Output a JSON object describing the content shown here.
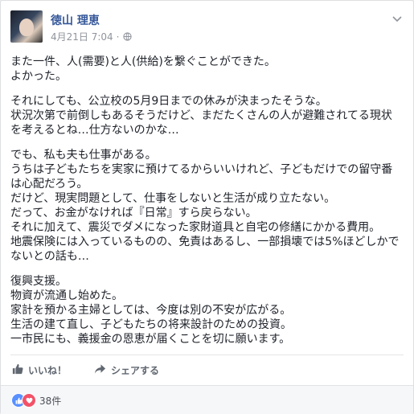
{
  "post": {
    "author": "徳山 理恵",
    "timestamp": "4月21日 7:04",
    "separator": "·",
    "privacy_icon": "globe-icon",
    "menu_icon": "chevron-down-icon",
    "paragraphs": [
      [
        "また一件、人(需要)と人(供給)を繋ぐことができた。",
        "よかった。"
      ],
      [
        "それにしても、公立校の5月9日までの休みが決まったそうな。",
        "状況次第で前倒しもあるそうだけど、まだたくさんの人が避難されてる現状",
        "を考えるとね…仕方ないのかな…"
      ],
      [
        "でも、私も夫も仕事がある。",
        "うちは子どもたちを実家に預けてるからいいけれど、子どもだけでの留守番",
        "は心配だろう。",
        "だけど、現実問題として、仕事をしないと生活が成り立たない。",
        "だって、お金がなければ『日常』すら戻らない。",
        "それに加えて、震災でダメになった家財道具と自宅の修繕にかかる費用。",
        "地震保険には入っているものの、免責はあるし、一部損壊では5%ほどしかで",
        "ないとの話も…"
      ],
      [
        "復興支援。",
        "物資が流通し始めた。",
        "家計を預かる主婦としては、今度は別の不安が広がる。",
        "生活の建て直し、子どもたちの将来設計のための投資。",
        "一市民にも、義援金の恩恵が届くことを切に願います。"
      ]
    ]
  },
  "actions": {
    "like_label": "いいね！",
    "share_label": "シェアする"
  },
  "reactions": {
    "count": "38件",
    "types": [
      "like",
      "love"
    ]
  },
  "colors": {
    "link_blue": "#365899",
    "like_blue": "#5890ff",
    "love_red": "#f25268",
    "meta_gray": "#90949c"
  }
}
